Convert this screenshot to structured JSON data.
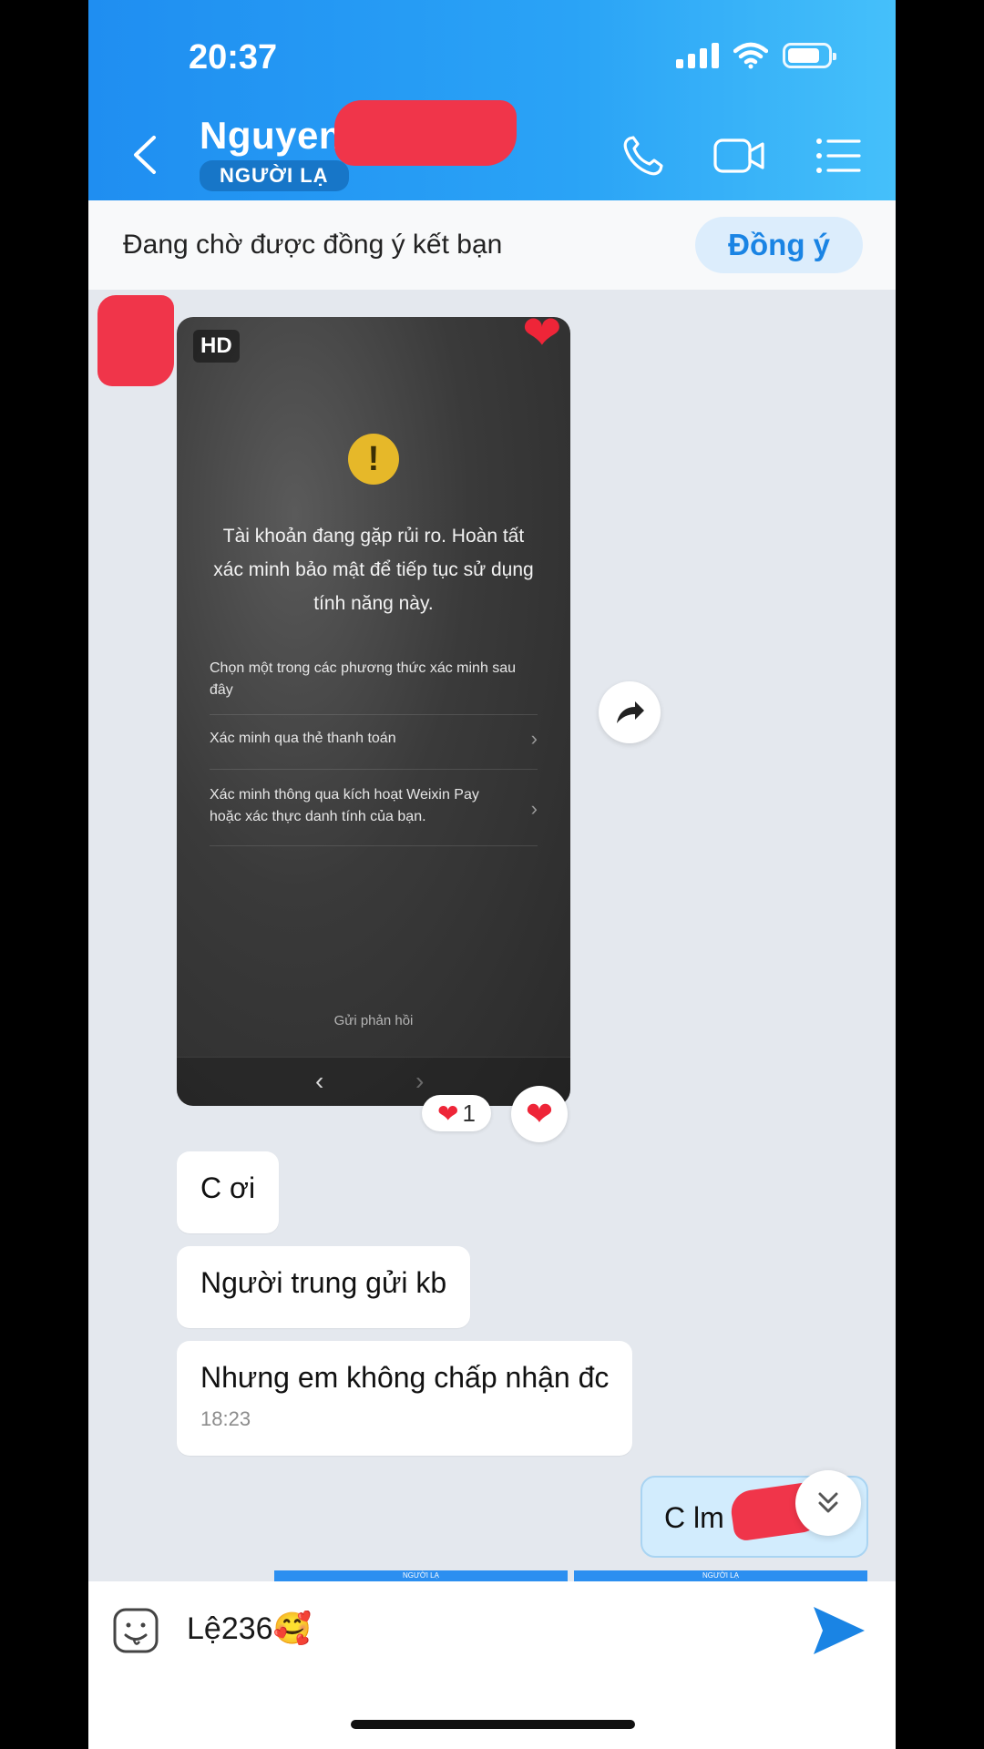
{
  "status_bar": {
    "time": "20:37"
  },
  "header": {
    "contact_name": "Nguyen",
    "badge": "NGƯỜI LẠ",
    "icons": {
      "back": "chevron-left-icon",
      "call": "phone-icon",
      "video": "video-camera-icon",
      "menu": "list-menu-icon"
    }
  },
  "friend_request": {
    "text": "Đang chờ được đồng ý kết bạn",
    "accept_label": "Đồng ý"
  },
  "image_message": {
    "hd_label": "HD",
    "warning_symbol": "!",
    "title": "Tài khoản đang gặp rủi ro. Hoàn tất xác minh bảo mật để tiếp tục sử dụng tính năng này.",
    "subtitle": "Chọn một trong các phương thức xác minh sau đây",
    "options": [
      "Xác minh qua thẻ thanh toán",
      "Xác minh thông qua kích hoạt Weixin Pay hoặc xác thực danh tính của bạn."
    ],
    "feedback": "Gửi phản hồi",
    "nav_prev": "‹",
    "nav_next": "›",
    "reaction_count": "1"
  },
  "messages": [
    {
      "text": "C ơi"
    },
    {
      "text": "Người trung gửi kb"
    },
    {
      "text": "Nhưng em không chấp nhận đc",
      "time": "18:23"
    }
  ],
  "outgoing_message": {
    "text": "C lm"
  },
  "thumbnails": {
    "label": "NGƯỜI LẠ"
  },
  "input": {
    "value": "Lệ236🥰"
  },
  "colors": {
    "header_start": "#1f8ef1",
    "header_end": "#45c0fa",
    "accent": "#1a84e4",
    "heart": "#ee2538",
    "redaction": "#f0354a"
  }
}
